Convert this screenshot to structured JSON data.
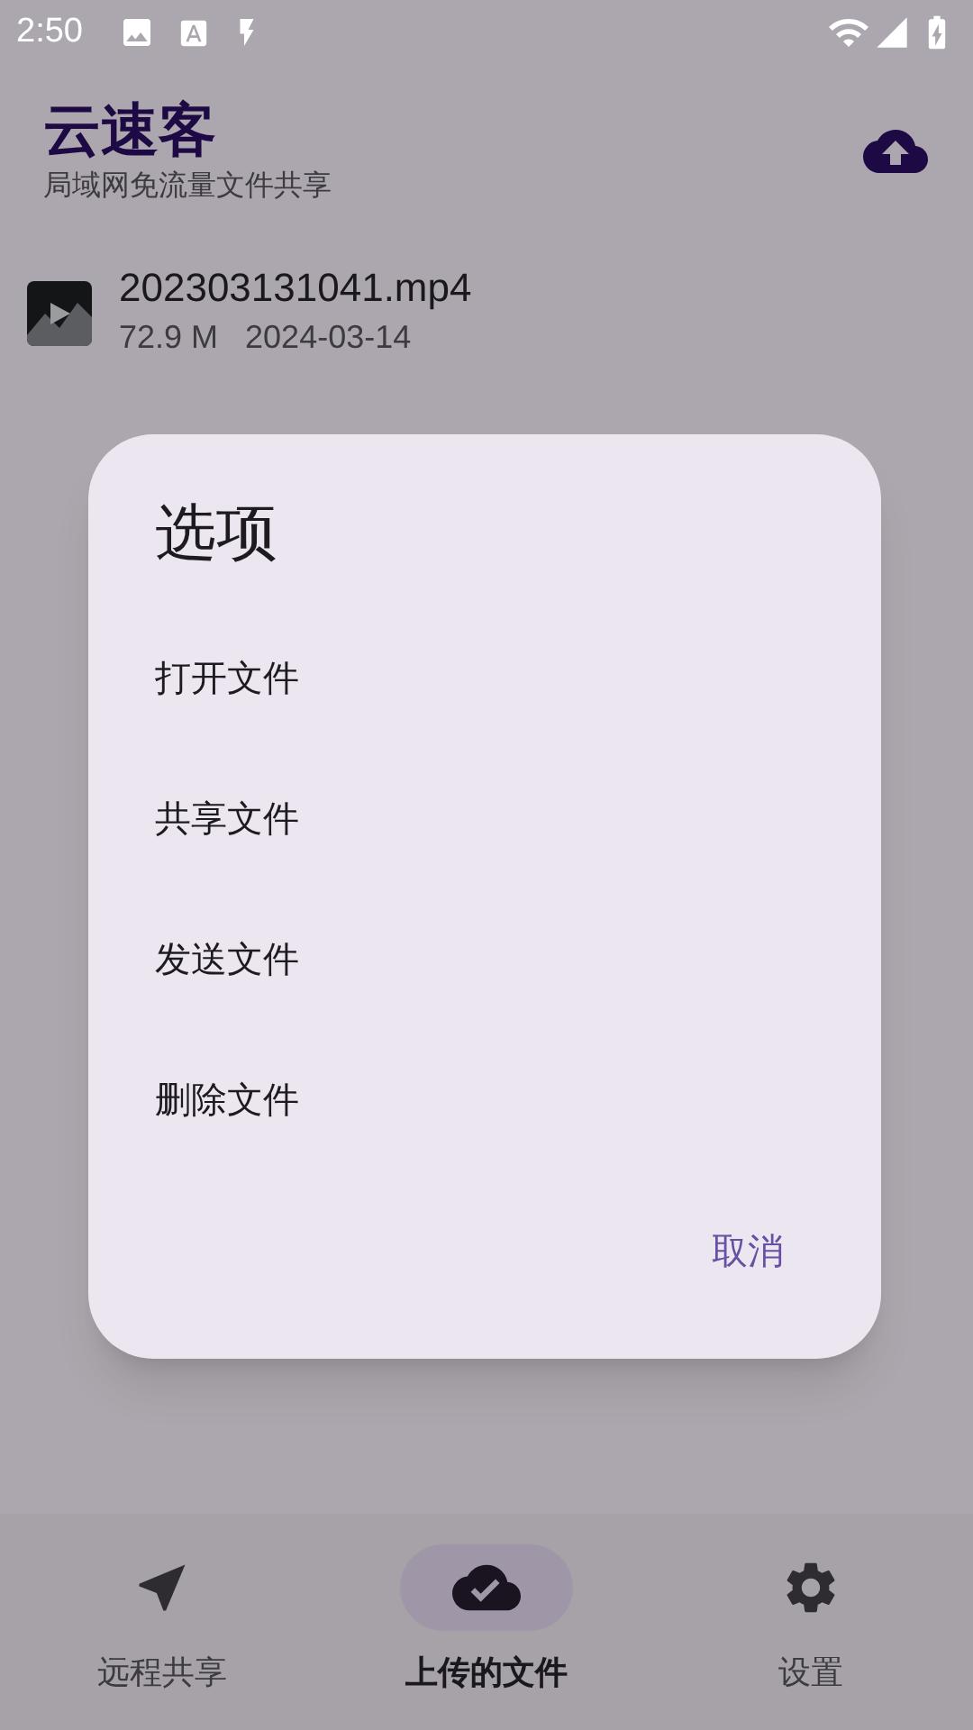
{
  "status_bar": {
    "time": "2:50"
  },
  "header": {
    "title": "云速客",
    "subtitle": "局域网免流量文件共享"
  },
  "files": [
    {
      "name": "202303131041.mp4",
      "size": "72.9 M",
      "date": "2024-03-14"
    }
  ],
  "dialog": {
    "title": "选项",
    "options": [
      "打开文件",
      "共享文件",
      "发送文件",
      "删除文件"
    ],
    "cancel": "取消"
  },
  "bottom_nav": [
    {
      "label": "远程共享",
      "kind": "share",
      "selected": false
    },
    {
      "label": "上传的文件",
      "kind": "uploaded",
      "selected": true
    },
    {
      "label": "设置",
      "kind": "settings",
      "selected": false
    }
  ]
}
